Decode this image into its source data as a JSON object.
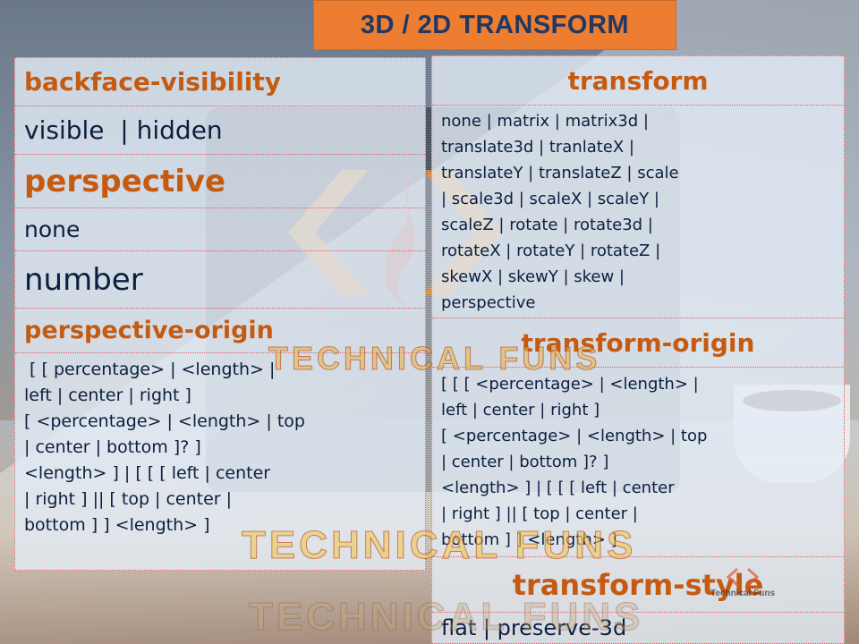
{
  "title": "3D / 2D TRANSFORM",
  "left": {
    "backface_header": "backface-visibility",
    "backface_values": "visible  | hidden",
    "perspective_header": "perspective",
    "perspective_none": "none",
    "perspective_number": "number",
    "origin_header": "perspective-origin",
    "origin_syntax": " [ [ percentage> | <length> |\nleft | center | right ]\n[ <percentage> | <length> | top\n| center | bottom ]? ]\n<length> ] | [ [ [ left | center\n| right ] || [ top | center |\nbottom ] ] <length> ]"
  },
  "right": {
    "transform_header": "transform",
    "transform_values": "none | matrix | matrix3d |\ntranslate3d | tranlateX |\ntranslateY | translateZ | scale\n| scale3d | scaleX | scaleY |\nscaleZ | rotate | rotate3d |\nrotateX | rotateY | rotateZ |\nskewX | skewY | skew |\nperspective",
    "origin_header": "transform-origin",
    "origin_syntax": "[ [ [ <percentage> | <length> |\nleft | center | right ]\n[ <percentage> | <length> | top\n| center | bottom ]? ]\n<length> ] | [ [ [ left | center\n| right ] || [ top | center |\nbottom ] ] <length> ]",
    "style_header": "transform-style",
    "style_values": "flat | preserve-3d"
  },
  "watermarks": {
    "mid": "TECHNICAL  FUNS",
    "bottom": "TECHNICAL FUNS",
    "bottom_faded": "TECHNICAL FUNS",
    "logo_small": "Technical Funs"
  },
  "colors": {
    "title_bg": "#ed7d31",
    "title_text": "#1f3864",
    "header_text": "#c55a11",
    "body_text": "#0b1f3f",
    "divider": "#e06060"
  }
}
